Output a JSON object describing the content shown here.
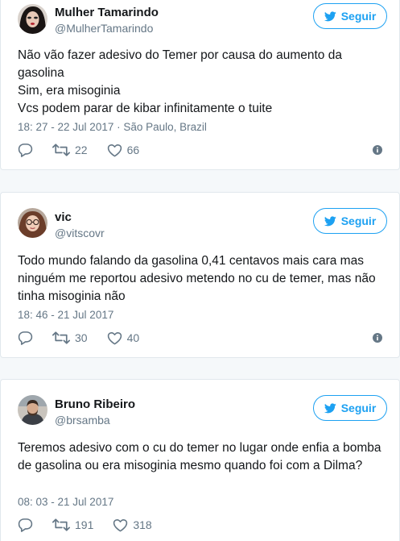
{
  "tweets": [
    {
      "name": "Mulher Tamarindo",
      "handle": "@MulherTamarindo",
      "follow_label": "Seguir",
      "lines": [
        "Não vão fazer adesivo do Temer por causa do aumento da gasolina",
        "Sim, era misoginia",
        "Vcs podem parar de kibar infinitamente o tuite"
      ],
      "timestamp": "18: 27 - 22 Jul 2017 · São Paulo, Brazil",
      "retweets": "22",
      "likes": "66"
    },
    {
      "name": "vic",
      "handle": "@vitscovr",
      "follow_label": "Seguir",
      "lines": [
        "Todo mundo falando da gasolina 0,41 centavos mais cara mas ninguém me reportou adesivo metendo no cu de temer, mas não tinha misoginia não"
      ],
      "timestamp": "18: 46 - 21 Jul 2017",
      "retweets": "30",
      "likes": "40"
    },
    {
      "name": "Bruno Ribeiro",
      "handle": "@brsamba",
      "follow_label": "Seguir",
      "lines": [
        "Teremos adesivo com o cu do temer no lugar onde enfia a bomba de gasolina ou era misoginia mesmo quando foi com a Dilma?"
      ],
      "timestamp": "08: 03 - 21 Jul 2017",
      "retweets": "191",
      "likes": "318"
    }
  ],
  "colors": {
    "brand": "#1da1f2",
    "text": "#14171a",
    "muted": "#657786",
    "border": "#e1e8ed"
  },
  "icons": [
    "twitter-bird-icon",
    "reply-icon",
    "retweet-icon",
    "heart-icon",
    "info-icon"
  ]
}
